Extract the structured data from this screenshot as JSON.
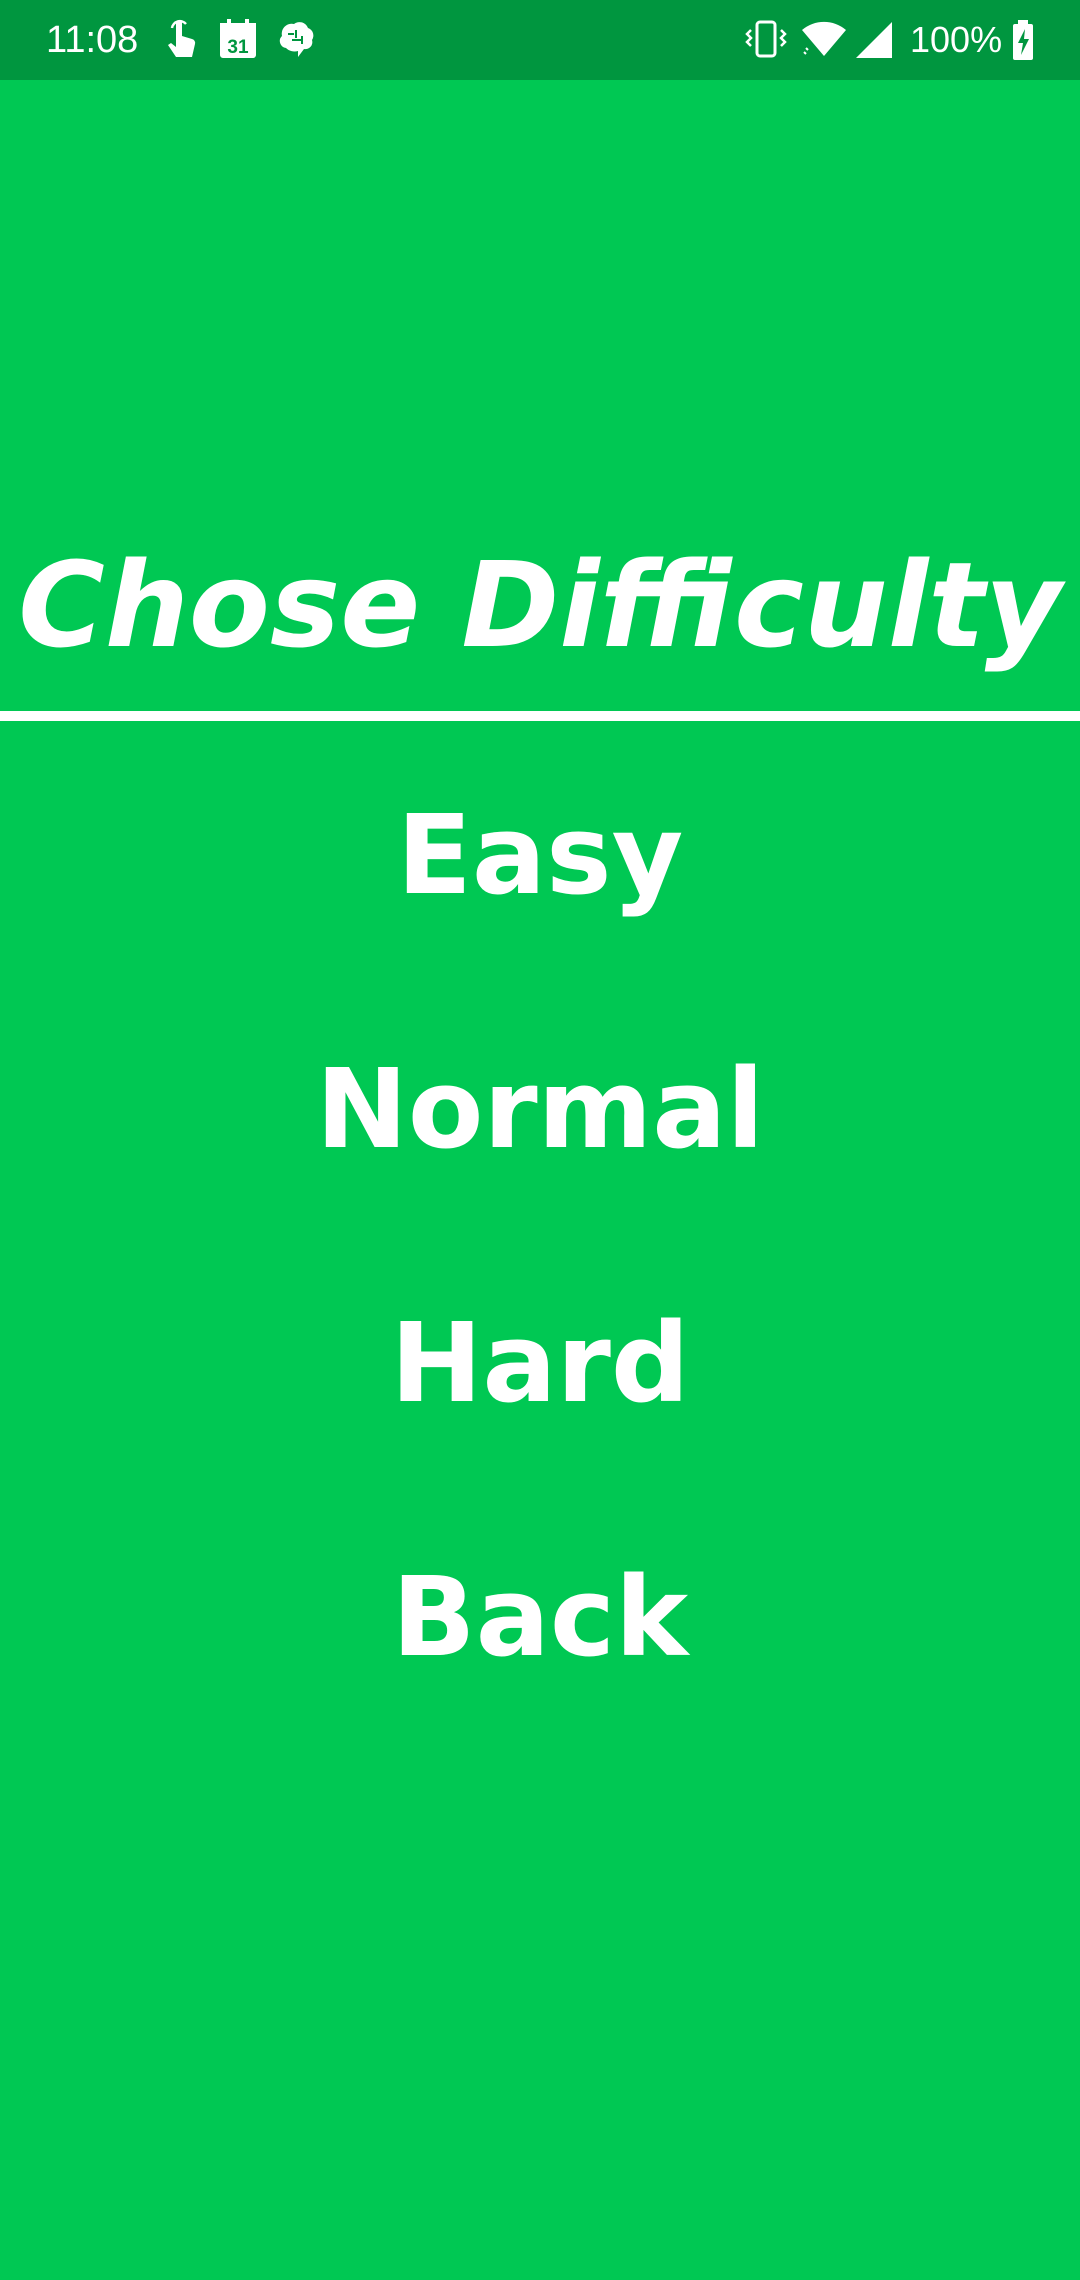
{
  "status_bar": {
    "time": "11:08",
    "battery_text": "100%",
    "notification_icons": [
      "touch-icon",
      "calendar-icon",
      "brain-icon"
    ],
    "calendar_day": "31",
    "system_icons": [
      "vibrate-icon",
      "wifi-icon",
      "signal-icon",
      "battery-charging-icon"
    ]
  },
  "screen": {
    "title": "Chose Difficulty",
    "menu": {
      "easy": "Easy",
      "normal": "Normal",
      "hard": "Hard",
      "back": "Back"
    }
  },
  "colors": {
    "background": "#00C853",
    "status_bar": "#00963F",
    "text": "#FFFFFF",
    "divider": "#FFFFFF"
  }
}
